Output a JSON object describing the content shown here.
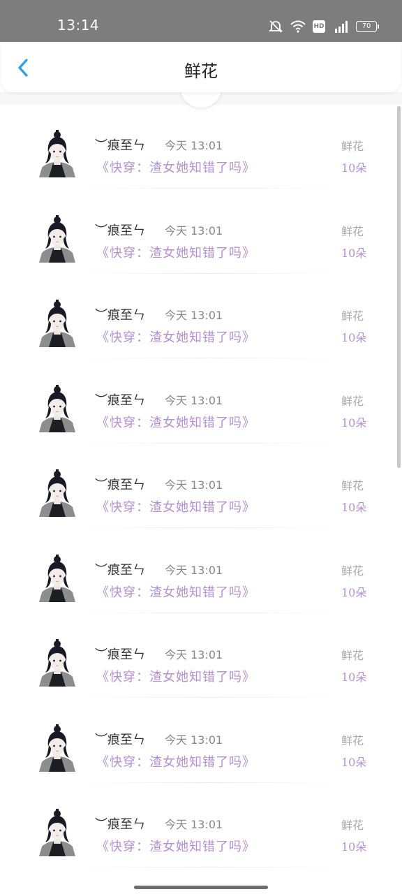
{
  "status_bar": {
    "time": "13:14",
    "battery": "70",
    "network": "4G",
    "hd": "HD"
  },
  "header": {
    "title": "鲜花"
  },
  "colors": {
    "accent": "#2ba0e6",
    "title_purple": "#b48fd1",
    "muted": "#a9a9a9"
  },
  "records": [
    {
      "username": "︶痕至ㄣ",
      "time": "今天 13:01",
      "book": "《快穿：渣女她知错了吗》",
      "gift": "鲜花",
      "count": "10朵"
    },
    {
      "username": "︶痕至ㄣ",
      "time": "今天 13:01",
      "book": "《快穿：渣女她知错了吗》",
      "gift": "鲜花",
      "count": "10朵"
    },
    {
      "username": "︶痕至ㄣ",
      "time": "今天 13:01",
      "book": "《快穿：渣女她知错了吗》",
      "gift": "鲜花",
      "count": "10朵"
    },
    {
      "username": "︶痕至ㄣ",
      "time": "今天 13:01",
      "book": "《快穿：渣女她知错了吗》",
      "gift": "鲜花",
      "count": "10朵"
    },
    {
      "username": "︶痕至ㄣ",
      "time": "今天 13:01",
      "book": "《快穿：渣女她知错了吗》",
      "gift": "鲜花",
      "count": "10朵"
    },
    {
      "username": "︶痕至ㄣ",
      "time": "今天 13:01",
      "book": "《快穿：渣女她知错了吗》",
      "gift": "鲜花",
      "count": "10朵"
    },
    {
      "username": "︶痕至ㄣ",
      "time": "今天 13:01",
      "book": "《快穿：渣女她知错了吗》",
      "gift": "鲜花",
      "count": "10朵"
    },
    {
      "username": "︶痕至ㄣ",
      "time": "今天 13:01",
      "book": "《快穿：渣女她知错了吗》",
      "gift": "鲜花",
      "count": "10朵"
    },
    {
      "username": "︶痕至ㄣ",
      "time": "今天 13:01",
      "book": "《快穿：渣女她知错了吗》",
      "gift": "鲜花",
      "count": "10朵"
    }
  ]
}
